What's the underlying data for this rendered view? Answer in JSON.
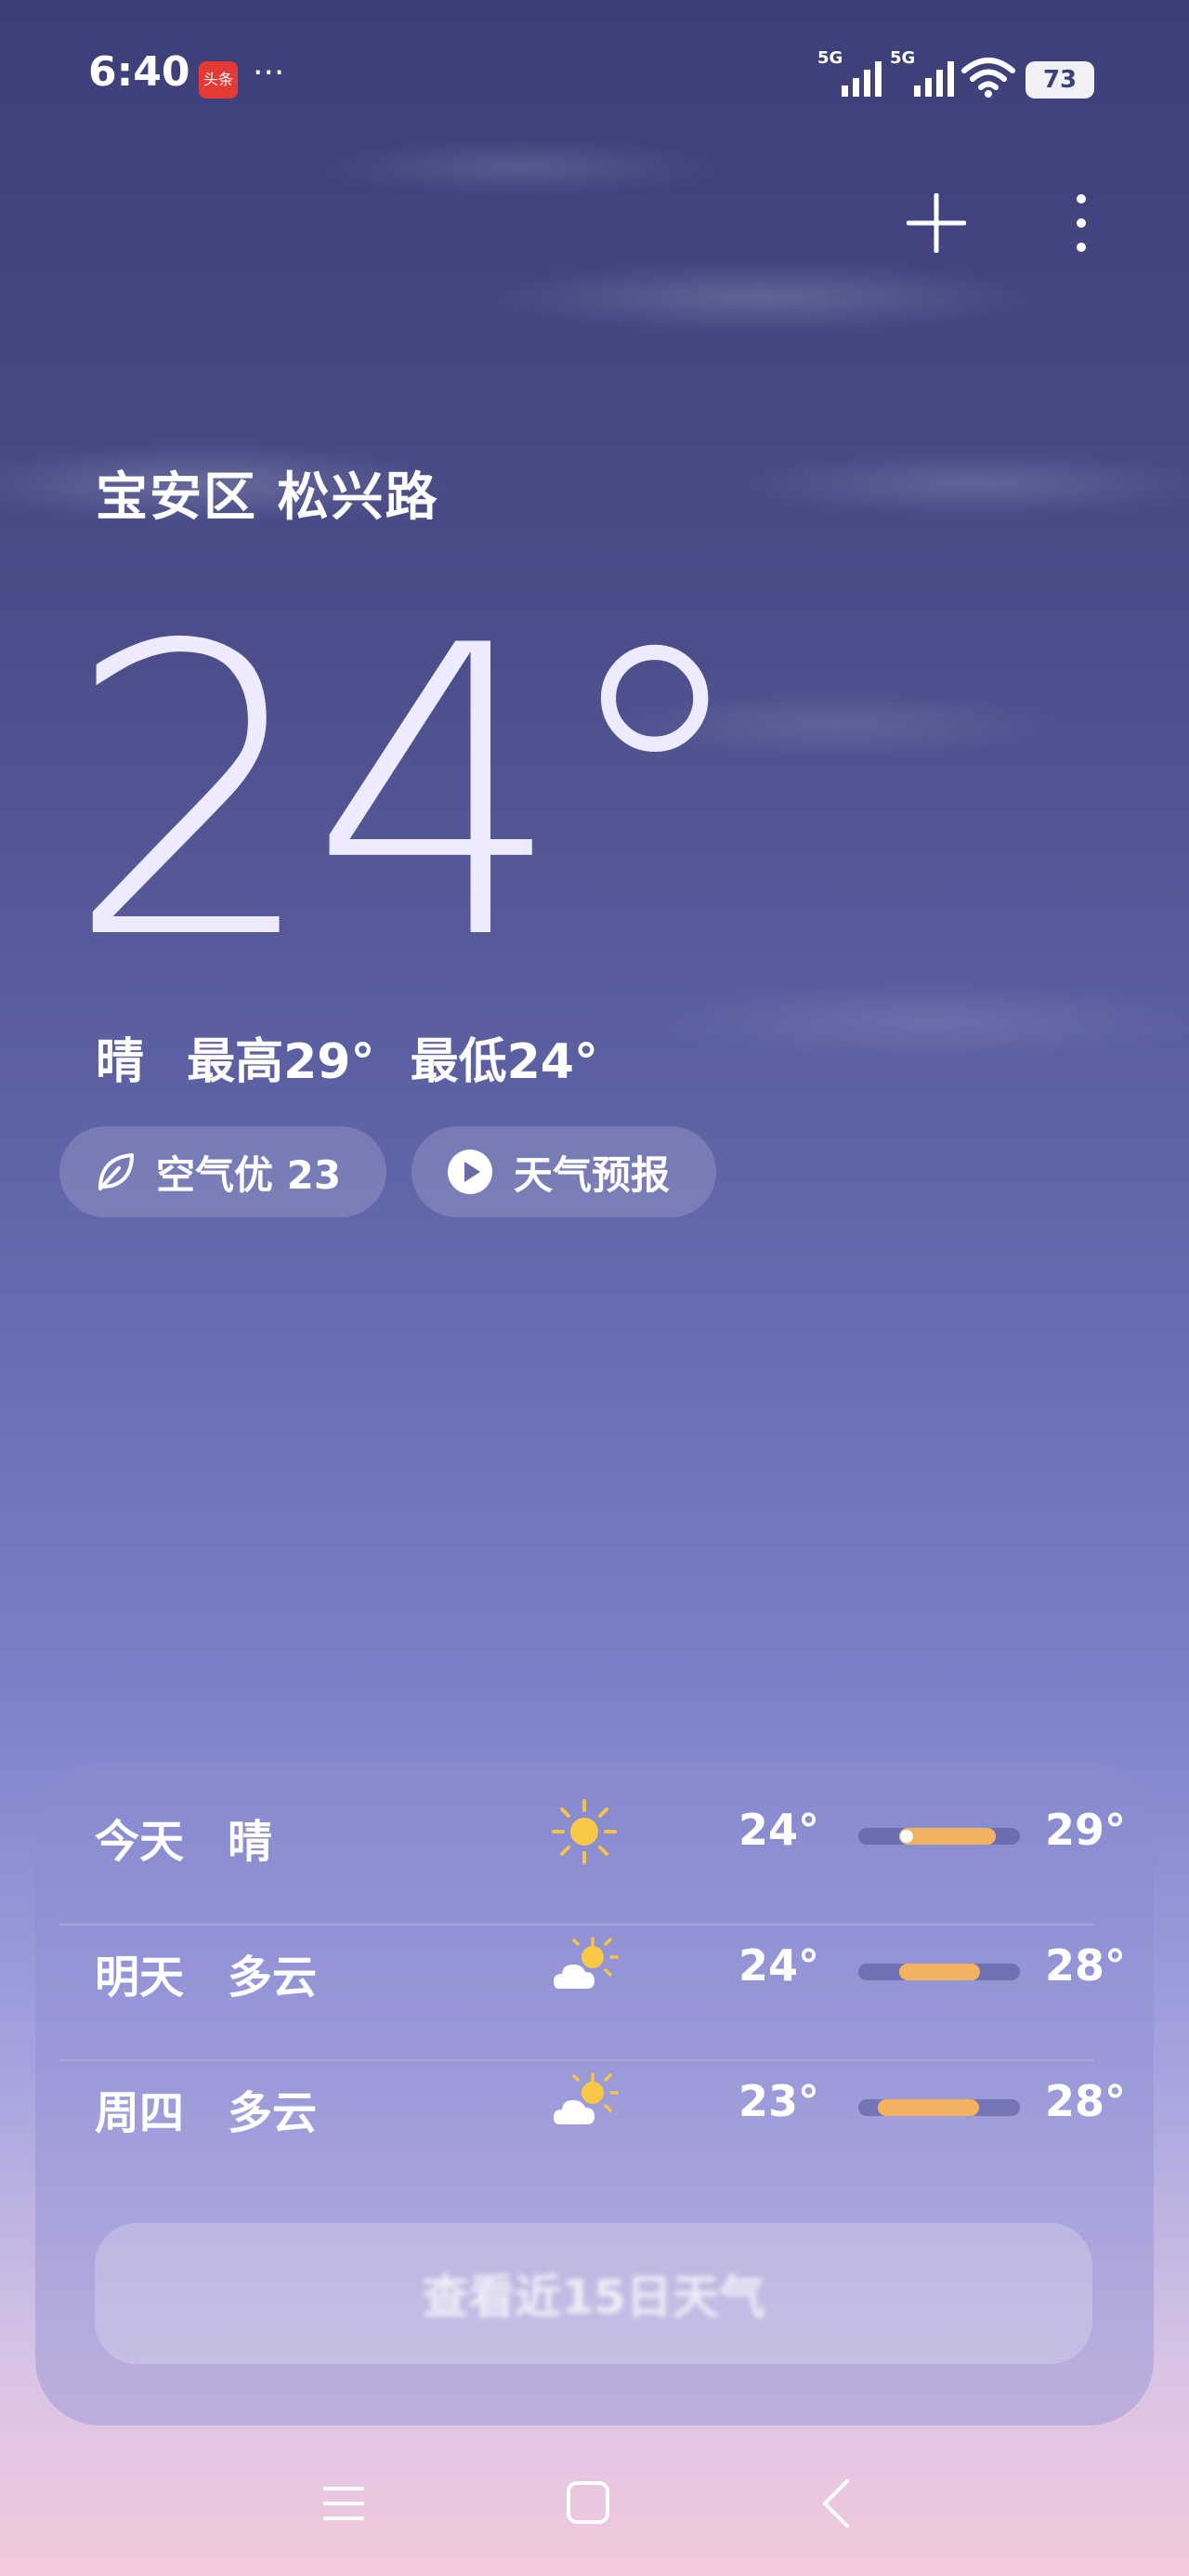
{
  "status_bar": {
    "time": "6:40",
    "app_badge": "头条",
    "more": "···",
    "signal_1_label": "5G",
    "signal_2_label": "5G",
    "battery": "73"
  },
  "location": "宝安区 松兴路",
  "current": {
    "temperature": "24°",
    "condition": "晴",
    "high": "最高29°",
    "low": "最低24°"
  },
  "pills": {
    "aqi": "空气优 23",
    "forecast": "天气预报"
  },
  "daily": [
    {
      "day": "今天",
      "condition": "晴",
      "icon": "sun-icon",
      "low": "24°",
      "high": "29°",
      "range_start": 0.25,
      "range_end": 0.85,
      "now": 0.3
    },
    {
      "day": "明天",
      "condition": "多云",
      "icon": "partly-cloudy-icon",
      "low": "24°",
      "high": "28°",
      "range_start": 0.25,
      "range_end": 0.75
    },
    {
      "day": "周四",
      "condition": "多云",
      "icon": "partly-cloudy-icon",
      "low": "23°",
      "high": "28°",
      "range_start": 0.12,
      "range_end": 0.75
    }
  ],
  "forecast_button": "查看近15日天气",
  "colors": {
    "range_fill": "#f2b260",
    "accent": "#5f64a8"
  }
}
